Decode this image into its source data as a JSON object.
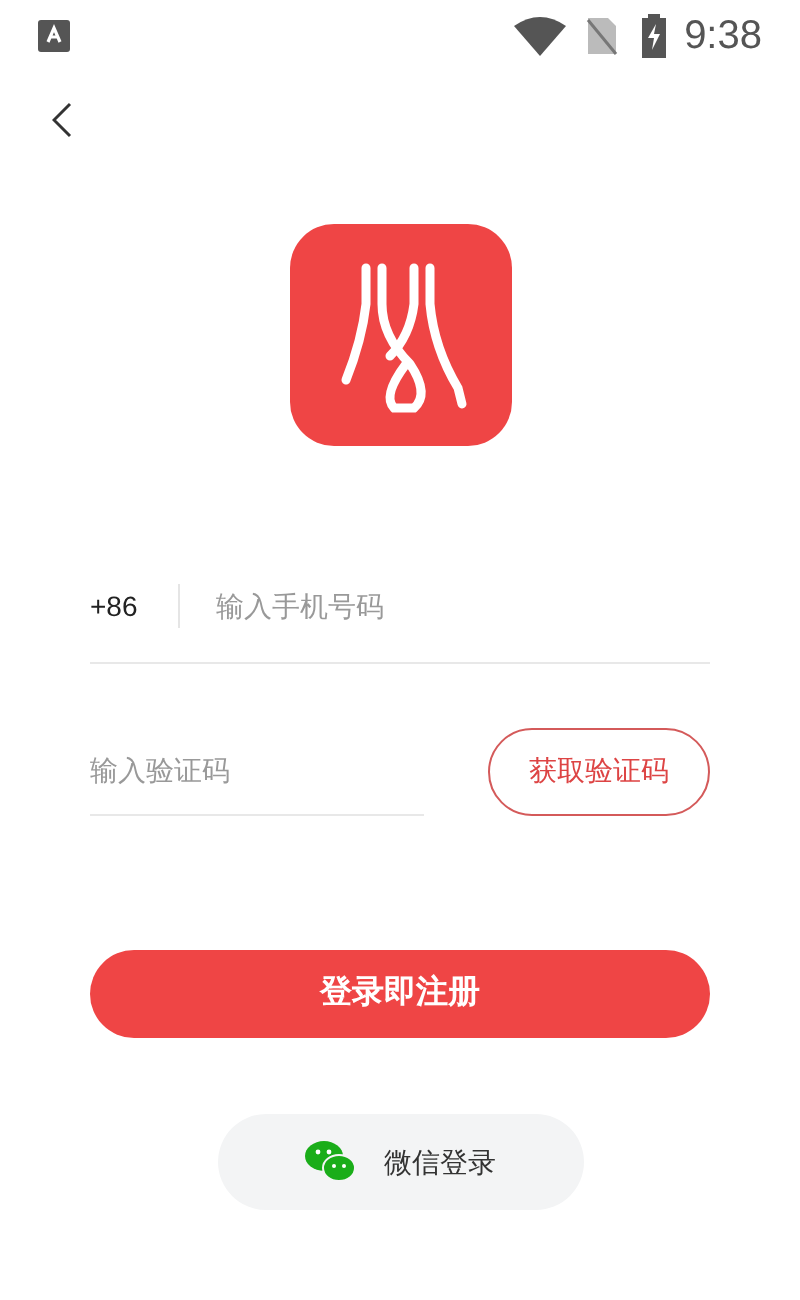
{
  "status_bar": {
    "time": "9:38"
  },
  "phone": {
    "country_code": "+86",
    "placeholder": "输入手机号码"
  },
  "code": {
    "placeholder": "输入验证码",
    "button": "获取验证码"
  },
  "login_button": "登录即注册",
  "wechat_button": "微信登录"
}
